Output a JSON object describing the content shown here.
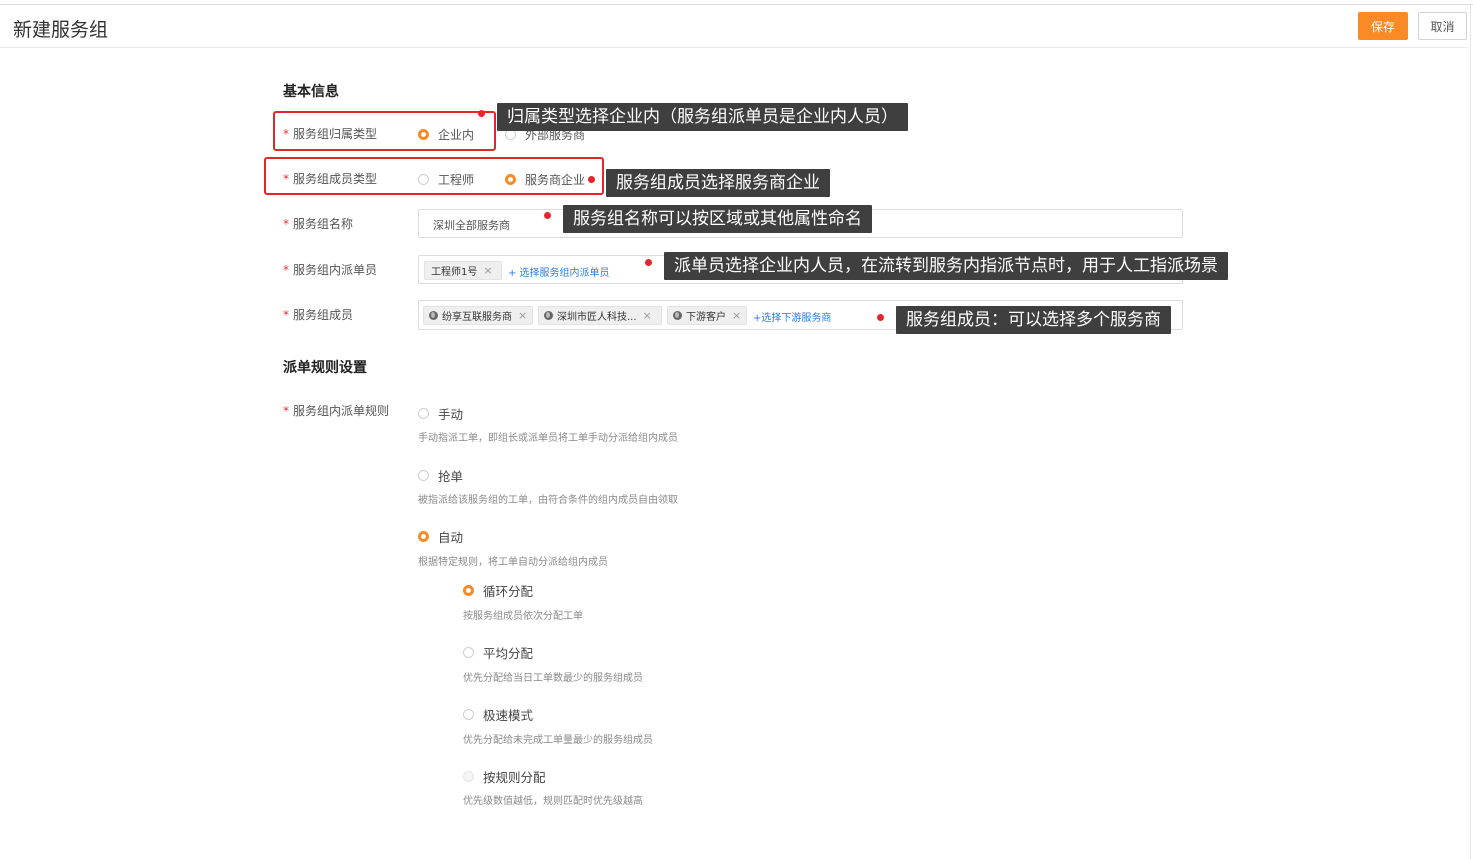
{
  "header": {
    "title": "新建服务组",
    "save_label": "保存",
    "cancel_label": "取消"
  },
  "basic": {
    "section_title": "基本信息",
    "ownership_type": {
      "label": "服务组归属类型",
      "options": [
        "企业内",
        "外部服务商"
      ],
      "selected": "企业内"
    },
    "member_type": {
      "label": "服务组成员类型",
      "options": [
        "工程师",
        "服务商企业"
      ],
      "selected": "服务商企业"
    },
    "group_name": {
      "label": "服务组名称",
      "value": "深圳全部服务商"
    },
    "dispatcher": {
      "label": "服务组内派单员",
      "tags": [
        "工程师1号"
      ],
      "add_text": "+ 选择服务组内派单员"
    },
    "members": {
      "label": "服务组成员",
      "tags": [
        "纷享互联服务商",
        "深圳市匠人科技...",
        "下游客户"
      ],
      "add_text": "+选择下游服务商"
    }
  },
  "rules": {
    "section_title": "派单规则设置",
    "label": "服务组内派单规则",
    "selected": "自动",
    "options": [
      {
        "name": "手动",
        "desc": "手动指派工单，即组长或派单员将工单手动分派给组内成员"
      },
      {
        "name": "抢单",
        "desc": "被指派给该服务组的工单，由符合条件的组内成员自由领取"
      },
      {
        "name": "自动",
        "desc": "根据特定规则，将工单自动分派给组内成员"
      }
    ],
    "auto_selected": "循环分配",
    "auto_modes": [
      {
        "name": "循环分配",
        "desc": "按服务组成员依次分配工单"
      },
      {
        "name": "平均分配",
        "desc": "优先分配给当日工单数最少的服务组成员"
      },
      {
        "name": "极速模式",
        "desc": "优先分配给未完成工单量最少的服务组成员"
      },
      {
        "name": "按规则分配",
        "desc": "优先级数值越低，规则匹配时优先级越高",
        "disabled": true
      }
    ]
  },
  "annotations": [
    "归属类型选择企业内（服务组派单员是企业内人员）",
    "服务组成员选择服务商企业",
    "服务组名称可以按区域或其他属性命名",
    "派单员选择企业内人员，在流转到服务内指派节点时，用于人工指派场景",
    "服务组成员：可以选择多个服务商"
  ],
  "colors": {
    "accent": "#f98a25",
    "annotation_red": "#e3262b",
    "callout_bg": "#3f3f3f",
    "link": "#2d7be5"
  }
}
